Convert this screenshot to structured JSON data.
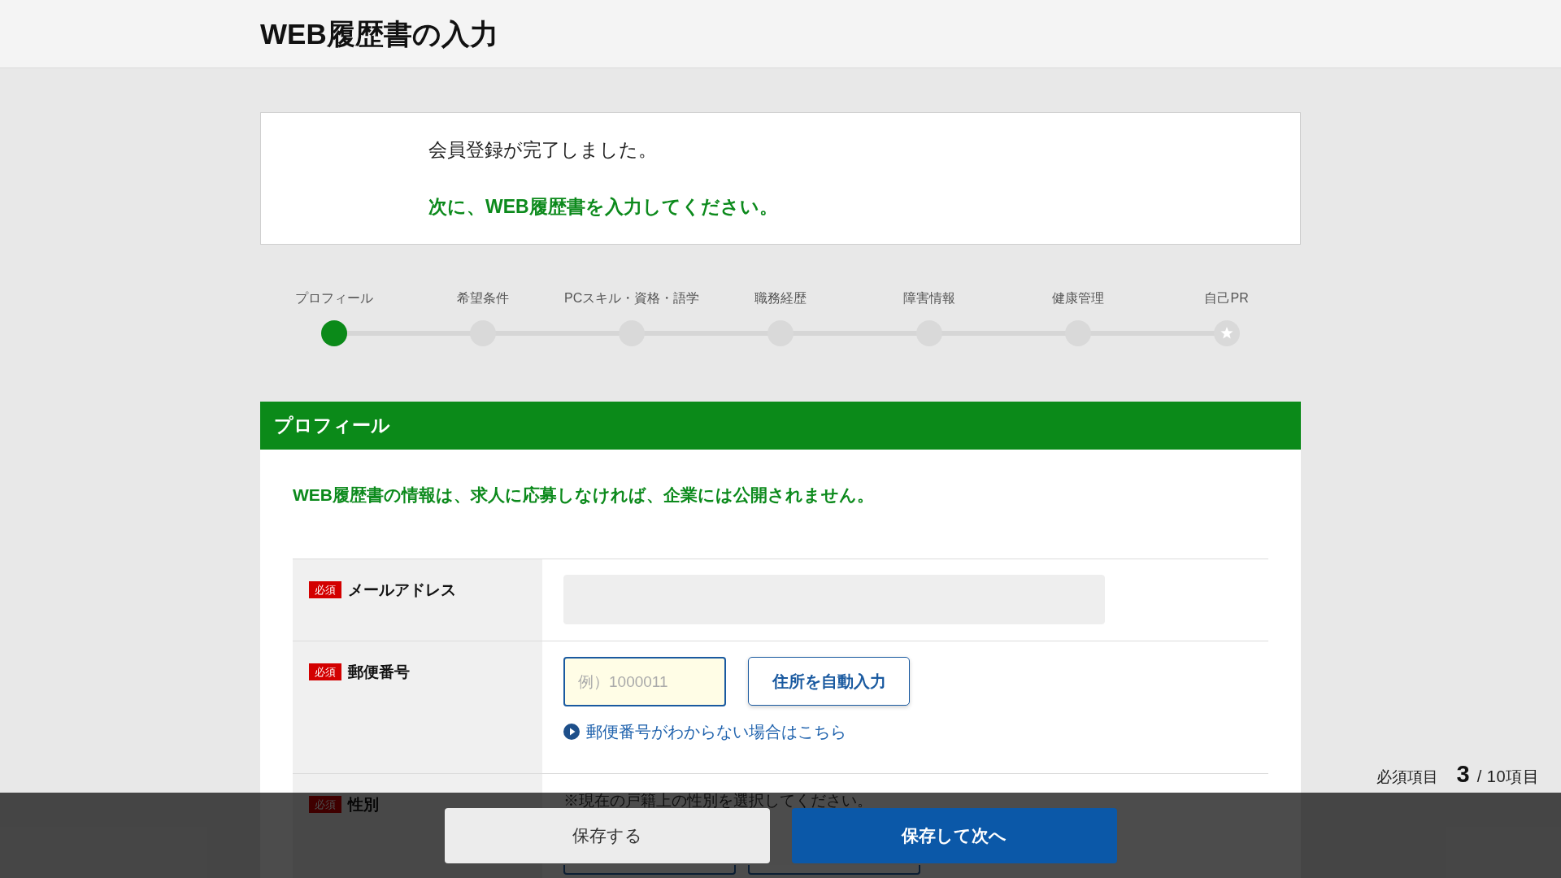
{
  "header": {
    "title": "WEB履歴書の入力"
  },
  "notice": {
    "message": "会員登録が完了しました。",
    "instruction": "次に、WEB履歴書を入力してください。"
  },
  "steps": [
    {
      "label": "プロフィール",
      "kind": "step",
      "selected": true
    },
    {
      "label": "希望条件",
      "kind": "step",
      "selected": false
    },
    {
      "label": "PCスキル・資格・語学",
      "kind": "step",
      "selected": false
    },
    {
      "label": "職務経歴",
      "kind": "step",
      "selected": false
    },
    {
      "label": "障害情報",
      "kind": "step",
      "selected": false
    },
    {
      "label": "健康管理",
      "kind": "step",
      "selected": false
    },
    {
      "label": "自己PR",
      "kind": "goal",
      "selected": false
    }
  ],
  "section": {
    "title": "プロフィール",
    "note": "WEB履歴書の情報は、求人に応募しなければ、企業には公開されません。",
    "rows": [
      {
        "badge": "必須",
        "label": "メールアドレス",
        "kind": "email",
        "field": {
          "disabled": true,
          "focused": false
        }
      },
      {
        "badge": "必須",
        "label": "郵便番号",
        "kind": "postal",
        "field": {
          "placeholder": "例）1000011",
          "disabled": false,
          "focused": true
        },
        "button": "住所を自動入力",
        "link": "郵便番号がわからない場合はこちら"
      },
      {
        "badge": "必須",
        "label": "性別",
        "kind": "choice",
        "hint": "※現在の戸籍上の性別を選択してください。"
      }
    ]
  },
  "required_counter": {
    "label": "必須項目",
    "count": "3",
    "total": "/ 10項目"
  },
  "actions": [
    {
      "label": "保存する",
      "kind": "secondary"
    },
    {
      "label": "保存して次へ",
      "kind": "primary"
    }
  ]
}
